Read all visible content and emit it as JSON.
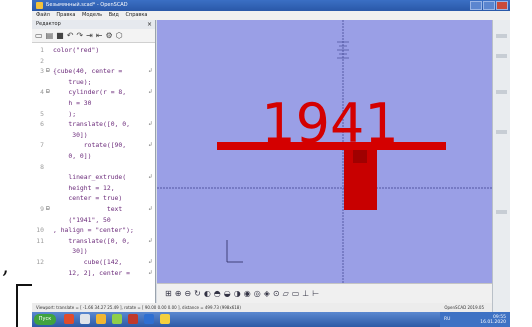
{
  "window": {
    "title": "Безымянный.scad* - OpenSCAD",
    "menu": [
      "Файл",
      "Правка",
      "Модель",
      "Вид",
      "Справка"
    ]
  },
  "editor": {
    "header": "Редактор",
    "close_glyph": "×",
    "toolbar_icons": [
      "new-icon",
      "open-icon",
      "save-icon",
      "undo-icon",
      "redo-icon",
      "indent-icon",
      "unindent-icon",
      "preview-icon",
      "render-icon"
    ],
    "lines": [
      {
        "n": "1",
        "fold": "",
        "text": "color(\"red\")",
        "wrap": ""
      },
      {
        "n": "2",
        "fold": "",
        "text": "",
        "wrap": ""
      },
      {
        "n": "3",
        "fold": "⊟",
        "text": "{cube(40, center =",
        "wrap": "↲"
      },
      {
        "n": "",
        "fold": "",
        "text": "    true);",
        "wrap": ""
      },
      {
        "n": "4",
        "fold": "⊟",
        "text": "    cylinder(r = 8,",
        "wrap": "↲"
      },
      {
        "n": "",
        "fold": "",
        "text": "    h = 30",
        "wrap": ""
      },
      {
        "n": "5",
        "fold": "",
        "text": "    );",
        "wrap": ""
      },
      {
        "n": "6",
        "fold": "",
        "text": "    translate([0, 0,",
        "wrap": "↲"
      },
      {
        "n": "",
        "fold": "",
        "text": "     30])",
        "wrap": ""
      },
      {
        "n": "7",
        "fold": "",
        "text": "        rotate([90,",
        "wrap": "↲"
      },
      {
        "n": "",
        "fold": "",
        "text": "    0, 0])",
        "wrap": ""
      },
      {
        "n": "8",
        "fold": "",
        "text": "",
        "wrap": ""
      },
      {
        "n": "",
        "fold": "",
        "text": "    linear_extrude(",
        "wrap": "↲"
      },
      {
        "n": "",
        "fold": "",
        "text": "    height = 12,",
        "wrap": ""
      },
      {
        "n": "",
        "fold": "",
        "text": "    center = true)",
        "wrap": ""
      },
      {
        "n": "9",
        "fold": "⊟",
        "text": "              text",
        "wrap": "↲"
      },
      {
        "n": "",
        "fold": "",
        "text": "    (\"1941\", 50",
        "wrap": ""
      },
      {
        "n": "10",
        "fold": "",
        "text": ", halign = \"center\");",
        "wrap": ""
      },
      {
        "n": "11",
        "fold": "",
        "text": "    translate([0, 0,",
        "wrap": "↲"
      },
      {
        "n": "",
        "fold": "",
        "text": "     30])",
        "wrap": ""
      },
      {
        "n": "12",
        "fold": "",
        "text": "        cube([142,",
        "wrap": "↲"
      },
      {
        "n": "",
        "fold": "",
        "text": "    12, 2], center =",
        "wrap": "↲"
      }
    ]
  },
  "viewport": {
    "model_text": "1941",
    "model_color": "#d40000",
    "background": "#9a9fe6"
  },
  "view_toolbar_icons": [
    "view-all-icon",
    "zoom-in-icon",
    "zoom-out-icon",
    "reset-view-icon",
    "right-view-icon",
    "top-view-icon",
    "bottom-view-icon",
    "left-view-icon",
    "front-view-icon",
    "back-view-icon",
    "diagonal-view-icon",
    "center-view-icon",
    "perspective-icon",
    "orthogonal-icon",
    "axes-icon",
    "scale-icon"
  ],
  "statusbar": {
    "left": "Viewport: translate = [ -1.66 34.27 25.49 ], rotate = [ 90.00 0.00 0.00 ], distance = 499.73 (998x618)",
    "right": "OpenSCAD 2019.05"
  },
  "taskbar": {
    "start_label": "Пуск",
    "tray_lang": "RU",
    "clock_time": "09:55",
    "clock_date": "16.01.2020"
  }
}
